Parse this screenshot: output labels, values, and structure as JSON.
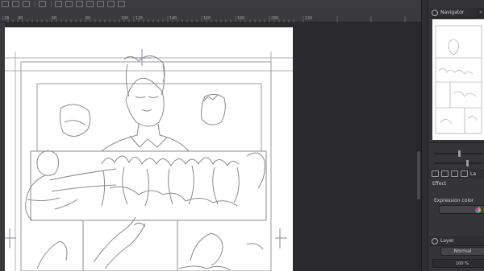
{
  "ruler": {
    "ticks": [
      "|20",
      "40",
      "60",
      "80",
      "100",
      "120",
      "140",
      "160",
      "180",
      "200",
      "220"
    ],
    "side_marker": "ls"
  },
  "navigator": {
    "title": "Navigator",
    "close_glyph": "✕"
  },
  "sub_tool_detail": {
    "tab_label": "La",
    "effect_label": "Effect",
    "expression_color_label": "Expression color",
    "expression_color_value": "G"
  },
  "layer": {
    "title": "Layer",
    "blend_mode": "Normal",
    "opacity_label": "100 %"
  },
  "colors": {
    "app_bg": "#2b2b2e",
    "panel_bg": "#353538",
    "paper": "#ffffff",
    "sketch_line": "#8a8a8e"
  }
}
